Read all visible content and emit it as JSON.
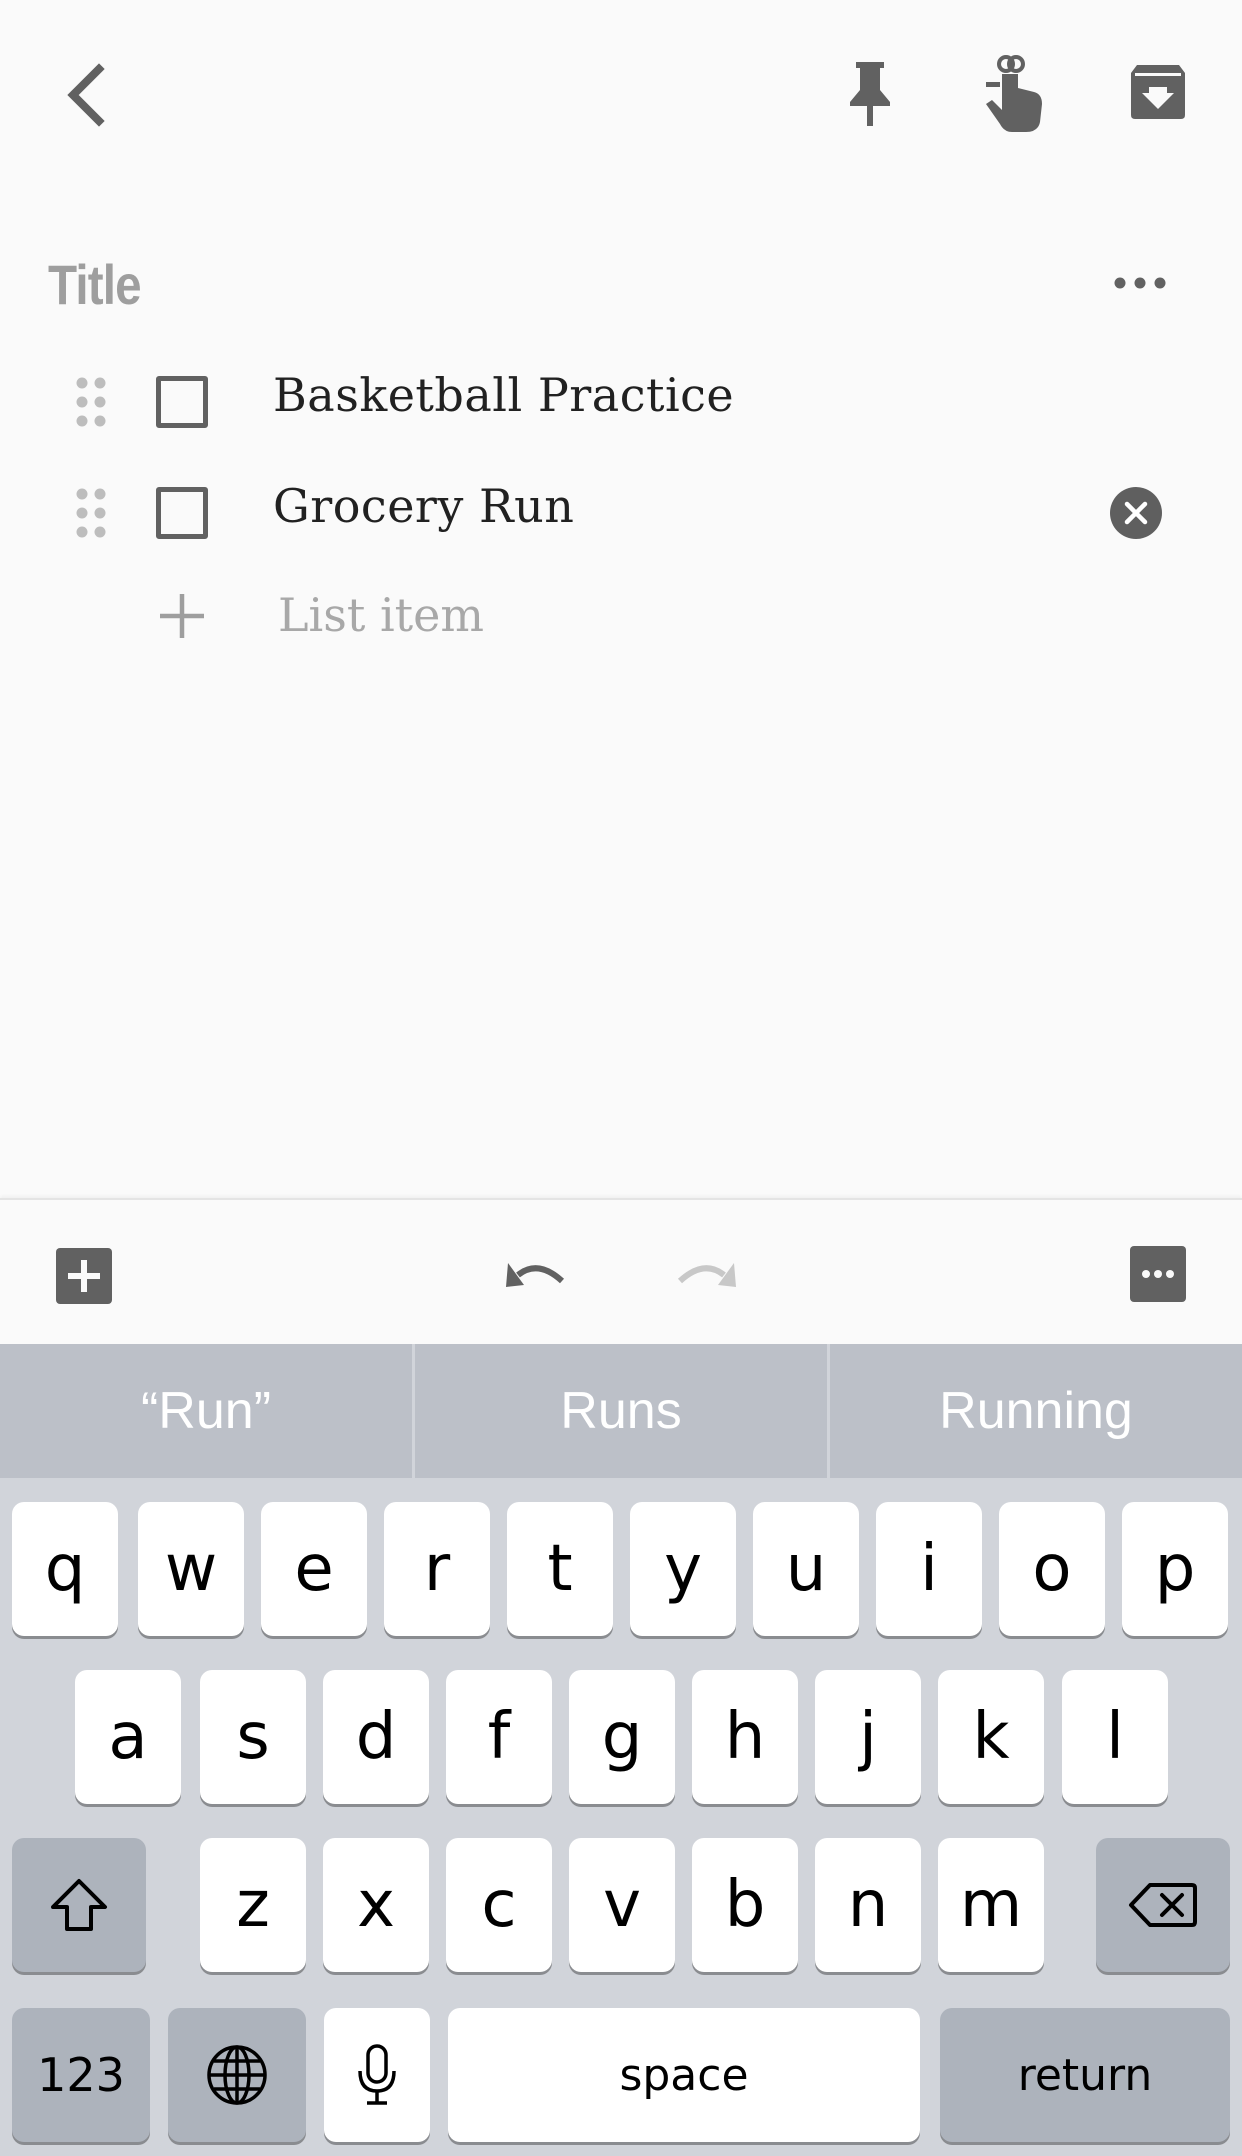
{
  "note": {
    "title_placeholder": "Title",
    "items": [
      {
        "text": "Basketball Practice",
        "checked": false
      },
      {
        "text": "Grocery Run",
        "checked": false
      }
    ],
    "add_item_placeholder": "List item"
  },
  "toolbar_icons": [
    "back-arrow-icon",
    "pin-icon",
    "reminder-icon",
    "archive-icon"
  ],
  "bottom_toolbar_icons": [
    "add-box-icon",
    "undo-icon",
    "redo-icon",
    "more-icon"
  ],
  "keyboard": {
    "suggestions": [
      "“Run”",
      "Runs",
      "Running"
    ],
    "row1": [
      "q",
      "w",
      "e",
      "r",
      "t",
      "y",
      "u",
      "i",
      "o",
      "p"
    ],
    "row2": [
      "a",
      "s",
      "d",
      "f",
      "g",
      "h",
      "j",
      "k",
      "l"
    ],
    "row3": [
      "z",
      "x",
      "c",
      "v",
      "b",
      "n",
      "m"
    ],
    "numbers_label": "123",
    "space_label": "space",
    "return_label": "return"
  },
  "colors": {
    "icon": "#616161",
    "background": "#fafafa",
    "keyboard_bg": "#d1d4da",
    "suggestion_bg": "#bcc0c8"
  }
}
